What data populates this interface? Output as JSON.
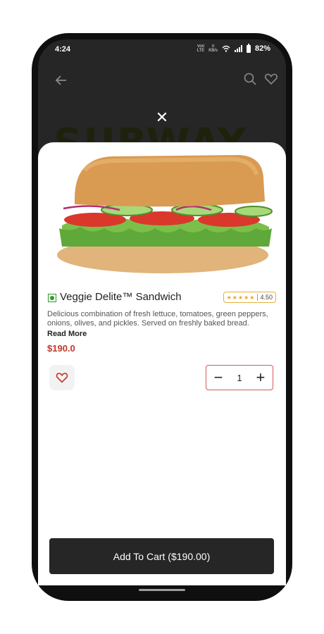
{
  "status_bar": {
    "time": "4:24",
    "net_label_top": "Vo0",
    "net_label_bottom": "LTE",
    "speed_top": "0",
    "speed_bottom": "KB/s",
    "battery_pct": "82%"
  },
  "header": {
    "back_icon": "arrow-left-icon",
    "search_icon": "search-icon",
    "favorite_icon": "heart-icon",
    "brand_text": "SUBWAY"
  },
  "modal": {
    "close_label": "✕",
    "product": {
      "name": "Veggie Delite™ Sandwich",
      "rating": "4.50",
      "rating_stars": 4.5,
      "description": "Delicious combination of fresh lettuce, tomatoes, green peppers, onions, olives, and pickles. Served on freshly baked bread.",
      "read_more": "Read More",
      "price": "$190.0",
      "quantity": "1",
      "minus_label": "−",
      "plus_label": "+"
    },
    "add_to_cart_label": "Add To Cart ($190.00)"
  },
  "colors": {
    "accent_red": "#c0392b",
    "veg_green": "#2e9b2e",
    "dark": "#262626"
  }
}
